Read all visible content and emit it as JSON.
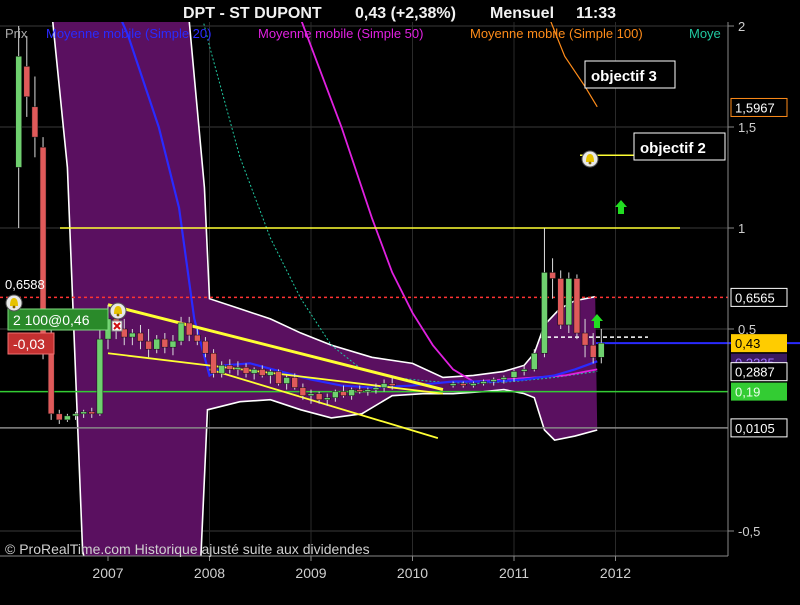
{
  "header": {
    "title": "DPT - ST DUPONT",
    "quote": "0,43 (+2,38%)",
    "period": "Mensuel",
    "time": "11:33"
  },
  "legend": {
    "price_label": "Prix",
    "items": [
      {
        "label": "Moyenne mobile (Simple 20)",
        "color": "#2a2aff"
      },
      {
        "label": "Moyenne mobile (Simple 50)",
        "color": "#e020e0"
      },
      {
        "label": "Moyenne mobile (Simple 100)",
        "color": "#ff8c1a"
      },
      {
        "label": "Moye",
        "color": "#20c8a0"
      }
    ]
  },
  "watermark": "© ProRealTime.com Historique ajusté suite aux dividendes",
  "annotations": {
    "target3": "objectif 3",
    "target2": "objectif 2",
    "position_label": "2 100@0,46",
    "pnl_label": "-0,03",
    "left_price": "0,6588"
  },
  "colors": {
    "background": "#000000",
    "band_fill": "#5a1060",
    "band_edge": "#ffffff",
    "up_candle": "#6fd06f",
    "down_candle": "#e05a5a",
    "trend_lines": "#ffff33",
    "resistance": "#ff3333",
    "support_green": "#33cc33",
    "ma20": "#2a2aff",
    "ma50": "#e020e0",
    "ma100": "#ff8c1a"
  },
  "chart_data": {
    "type": "candlestick",
    "x_axis": {
      "tick_labels": [
        "2007",
        "2008",
        "2009",
        "2010",
        "2011",
        "2012"
      ]
    },
    "y_axis": {
      "tick_labels": [
        "2",
        "1,5",
        "1",
        "0,5",
        "-0,5"
      ],
      "ticks": [
        2,
        1.5,
        1,
        0.5,
        -0.5
      ]
    },
    "right_axis_labels": [
      {
        "text": "1,5967",
        "value": 1.5967,
        "style": "outline",
        "color": "#ff8c1a"
      },
      {
        "text": "0,6565",
        "value": 0.6565,
        "style": "outline",
        "color": "#ffffff"
      },
      {
        "text": "0,43",
        "value": 0.43,
        "style": "fill",
        "color": "#ffcc00"
      },
      {
        "text": "0,3335",
        "value": 0.3335,
        "style": "fill",
        "color": "#3a1a60"
      },
      {
        "text": "0,2887",
        "value": 0.2887,
        "style": "outline",
        "color": "#ffffff"
      },
      {
        "text": "0,19",
        "value": 0.19,
        "style": "fill",
        "color": "#33cc33"
      },
      {
        "text": "0,0105",
        "value": 0.0105,
        "style": "outline",
        "color": "#ffffff"
      }
    ],
    "horizontal_levels": [
      {
        "name": "objective-1",
        "value": 1.0,
        "color": "#ffff33"
      },
      {
        "name": "objective-2",
        "value": 1.36,
        "color": "#ffff33"
      },
      {
        "name": "resistance",
        "value": 0.6565,
        "color": "#ff3333",
        "dashed": true
      },
      {
        "name": "last-price",
        "value": 0.43,
        "color": "#2a2aff"
      },
      {
        "name": "support",
        "value": 0.19,
        "color": "#33cc33"
      },
      {
        "name": "band-low",
        "value": 0.0105,
        "color": "#888888"
      }
    ],
    "candles": [
      {
        "t": 2006.12,
        "o": 1.3,
        "h": 2.0,
        "l": 1.0,
        "c": 1.85
      },
      {
        "t": 2006.2,
        "o": 1.8,
        "h": 1.95,
        "l": 1.55,
        "c": 1.65
      },
      {
        "t": 2006.28,
        "o": 1.6,
        "h": 1.75,
        "l": 1.35,
        "c": 1.45
      },
      {
        "t": 2006.36,
        "o": 1.4,
        "h": 1.45,
        "l": 0.35,
        "c": 0.4
      },
      {
        "t": 2006.44,
        "o": 0.4,
        "h": 0.5,
        "l": 0.05,
        "c": 0.08
      },
      {
        "t": 2006.52,
        "o": 0.08,
        "h": 0.1,
        "l": 0.03,
        "c": 0.05
      },
      {
        "t": 2006.6,
        "o": 0.05,
        "h": 0.08,
        "l": 0.04,
        "c": 0.07
      },
      {
        "t": 2006.68,
        "o": 0.07,
        "h": 0.09,
        "l": 0.05,
        "c": 0.08
      },
      {
        "t": 2006.76,
        "o": 0.08,
        "h": 0.1,
        "l": 0.06,
        "c": 0.09
      },
      {
        "t": 2006.84,
        "o": 0.09,
        "h": 0.11,
        "l": 0.06,
        "c": 0.08
      },
      {
        "t": 2006.92,
        "o": 0.08,
        "h": 0.5,
        "l": 0.07,
        "c": 0.45
      },
      {
        "t": 2007.0,
        "o": 0.45,
        "h": 0.62,
        "l": 0.4,
        "c": 0.55
      },
      {
        "t": 2007.08,
        "o": 0.55,
        "h": 0.6,
        "l": 0.45,
        "c": 0.5
      },
      {
        "t": 2007.16,
        "o": 0.5,
        "h": 0.55,
        "l": 0.42,
        "c": 0.46
      },
      {
        "t": 2007.24,
        "o": 0.46,
        "h": 0.5,
        "l": 0.42,
        "c": 0.48
      },
      {
        "t": 2007.32,
        "o": 0.48,
        "h": 0.52,
        "l": 0.4,
        "c": 0.44
      },
      {
        "t": 2007.4,
        "o": 0.44,
        "h": 0.5,
        "l": 0.36,
        "c": 0.4
      },
      {
        "t": 2007.48,
        "o": 0.4,
        "h": 0.47,
        "l": 0.38,
        "c": 0.45
      },
      {
        "t": 2007.56,
        "o": 0.45,
        "h": 0.48,
        "l": 0.38,
        "c": 0.41
      },
      {
        "t": 2007.64,
        "o": 0.41,
        "h": 0.47,
        "l": 0.37,
        "c": 0.44
      },
      {
        "t": 2007.72,
        "o": 0.44,
        "h": 0.56,
        "l": 0.42,
        "c": 0.53
      },
      {
        "t": 2007.8,
        "o": 0.53,
        "h": 0.56,
        "l": 0.44,
        "c": 0.47
      },
      {
        "t": 2007.88,
        "o": 0.47,
        "h": 0.5,
        "l": 0.42,
        "c": 0.44
      },
      {
        "t": 2007.96,
        "o": 0.44,
        "h": 0.46,
        "l": 0.36,
        "c": 0.38
      },
      {
        "t": 2008.04,
        "o": 0.38,
        "h": 0.4,
        "l": 0.26,
        "c": 0.28
      },
      {
        "t": 2008.12,
        "o": 0.28,
        "h": 0.34,
        "l": 0.26,
        "c": 0.32
      },
      {
        "t": 2008.2,
        "o": 0.32,
        "h": 0.35,
        "l": 0.28,
        "c": 0.3
      },
      {
        "t": 2008.28,
        "o": 0.3,
        "h": 0.34,
        "l": 0.27,
        "c": 0.31
      },
      {
        "t": 2008.36,
        "o": 0.31,
        "h": 0.33,
        "l": 0.26,
        "c": 0.28
      },
      {
        "t": 2008.44,
        "o": 0.28,
        "h": 0.31,
        "l": 0.25,
        "c": 0.3
      },
      {
        "t": 2008.52,
        "o": 0.3,
        "h": 0.32,
        "l": 0.26,
        "c": 0.27
      },
      {
        "t": 2008.6,
        "o": 0.27,
        "h": 0.3,
        "l": 0.23,
        "c": 0.29
      },
      {
        "t": 2008.68,
        "o": 0.29,
        "h": 0.3,
        "l": 0.22,
        "c": 0.23
      },
      {
        "t": 2008.76,
        "o": 0.23,
        "h": 0.27,
        "l": 0.2,
        "c": 0.26
      },
      {
        "t": 2008.84,
        "o": 0.26,
        "h": 0.28,
        "l": 0.2,
        "c": 0.21
      },
      {
        "t": 2008.92,
        "o": 0.21,
        "h": 0.23,
        "l": 0.15,
        "c": 0.17
      },
      {
        "t": 2009.0,
        "o": 0.17,
        "h": 0.2,
        "l": 0.13,
        "c": 0.18
      },
      {
        "t": 2009.08,
        "o": 0.18,
        "h": 0.19,
        "l": 0.13,
        "c": 0.15
      },
      {
        "t": 2009.16,
        "o": 0.15,
        "h": 0.18,
        "l": 0.12,
        "c": 0.16
      },
      {
        "t": 2009.24,
        "o": 0.16,
        "h": 0.2,
        "l": 0.14,
        "c": 0.19
      },
      {
        "t": 2009.32,
        "o": 0.19,
        "h": 0.22,
        "l": 0.16,
        "c": 0.17
      },
      {
        "t": 2009.4,
        "o": 0.17,
        "h": 0.21,
        "l": 0.15,
        "c": 0.2
      },
      {
        "t": 2009.48,
        "o": 0.2,
        "h": 0.22,
        "l": 0.18,
        "c": 0.19
      },
      {
        "t": 2009.56,
        "o": 0.19,
        "h": 0.21,
        "l": 0.17,
        "c": 0.2
      },
      {
        "t": 2009.64,
        "o": 0.2,
        "h": 0.23,
        "l": 0.18,
        "c": 0.21
      },
      {
        "t": 2009.72,
        "o": 0.21,
        "h": 0.25,
        "l": 0.19,
        "c": 0.23
      },
      {
        "t": 2009.8,
        "o": 0.23,
        "h": 0.26,
        "l": 0.2,
        "c": 0.22
      },
      {
        "t": 2010.4,
        "o": 0.22,
        "h": 0.24,
        "l": 0.21,
        "c": 0.23
      },
      {
        "t": 2010.5,
        "o": 0.23,
        "h": 0.24,
        "l": 0.21,
        "c": 0.22
      },
      {
        "t": 2010.6,
        "o": 0.22,
        "h": 0.24,
        "l": 0.21,
        "c": 0.23
      },
      {
        "t": 2010.7,
        "o": 0.23,
        "h": 0.25,
        "l": 0.22,
        "c": 0.24
      },
      {
        "t": 2010.8,
        "o": 0.24,
        "h": 0.26,
        "l": 0.22,
        "c": 0.25
      },
      {
        "t": 2010.9,
        "o": 0.25,
        "h": 0.27,
        "l": 0.23,
        "c": 0.26
      },
      {
        "t": 2011.0,
        "o": 0.26,
        "h": 0.3,
        "l": 0.24,
        "c": 0.29
      },
      {
        "t": 2011.1,
        "o": 0.29,
        "h": 0.32,
        "l": 0.27,
        "c": 0.3
      },
      {
        "t": 2011.2,
        "o": 0.3,
        "h": 0.4,
        "l": 0.29,
        "c": 0.38
      },
      {
        "t": 2011.3,
        "o": 0.38,
        "h": 1.0,
        "l": 0.36,
        "c": 0.78
      },
      {
        "t": 2011.38,
        "o": 0.78,
        "h": 0.85,
        "l": 0.65,
        "c": 0.75
      },
      {
        "t": 2011.46,
        "o": 0.75,
        "h": 0.79,
        "l": 0.5,
        "c": 0.52
      },
      {
        "t": 2011.54,
        "o": 0.52,
        "h": 0.78,
        "l": 0.48,
        "c": 0.75
      },
      {
        "t": 2011.62,
        "o": 0.75,
        "h": 0.77,
        "l": 0.45,
        "c": 0.48
      },
      {
        "t": 2011.7,
        "o": 0.48,
        "h": 0.55,
        "l": 0.36,
        "c": 0.42
      },
      {
        "t": 2011.78,
        "o": 0.42,
        "h": 0.48,
        "l": 0.33,
        "c": 0.36
      },
      {
        "t": 2011.86,
        "o": 0.36,
        "h": 0.5,
        "l": 0.33,
        "c": 0.43
      }
    ],
    "bollinger_upper": [
      [
        2006.4,
        2.3
      ],
      [
        2006.6,
        2.3
      ],
      [
        2006.9,
        2.3
      ],
      [
        2007.2,
        2.3
      ],
      [
        2007.6,
        2.3
      ],
      [
        2007.75,
        2.3
      ],
      [
        2007.95,
        1.2
      ],
      [
        2008.0,
        0.65
      ],
      [
        2008.3,
        0.6
      ],
      [
        2008.6,
        0.55
      ],
      [
        2008.9,
        0.48
      ],
      [
        2009.2,
        0.42
      ],
      [
        2009.6,
        0.36
      ],
      [
        2010.0,
        0.33
      ],
      [
        2010.3,
        0.26
      ],
      [
        2010.6,
        0.27
      ],
      [
        2010.9,
        0.29
      ],
      [
        2011.1,
        0.32
      ],
      [
        2011.2,
        0.38
      ],
      [
        2011.3,
        0.52
      ],
      [
        2011.45,
        0.6
      ],
      [
        2011.6,
        0.64
      ],
      [
        2011.8,
        0.66
      ]
    ],
    "bollinger_lower": [
      [
        2006.4,
        2.3
      ],
      [
        2006.6,
        1.3
      ],
      [
        2006.75,
        -0.6
      ],
      [
        2006.85,
        -0.8
      ],
      [
        2007.0,
        -0.8
      ],
      [
        2007.5,
        -0.8
      ],
      [
        2007.9,
        -0.8
      ],
      [
        2007.98,
        0.1
      ],
      [
        2008.3,
        0.14
      ],
      [
        2008.6,
        0.15
      ],
      [
        2008.9,
        0.1
      ],
      [
        2009.2,
        0.06
      ],
      [
        2009.5,
        0.08
      ],
      [
        2009.8,
        0.17
      ],
      [
        2010.1,
        0.18
      ],
      [
        2010.4,
        0.18
      ],
      [
        2010.7,
        0.19
      ],
      [
        2010.9,
        0.2
      ],
      [
        2011.1,
        0.18
      ],
      [
        2011.2,
        0.16
      ],
      [
        2011.3,
        0.0
      ],
      [
        2011.4,
        -0.05
      ],
      [
        2011.6,
        -0.03
      ],
      [
        2011.82,
        0.0
      ]
    ],
    "ma20": [
      [
        2006.9,
        2.3
      ],
      [
        2007.2,
        1.95
      ],
      [
        2007.5,
        1.5
      ],
      [
        2007.7,
        1.1
      ],
      [
        2007.85,
        0.55
      ],
      [
        2008.0,
        0.27
      ],
      [
        2008.15,
        0.32
      ],
      [
        2008.4,
        0.33
      ],
      [
        2008.7,
        0.29
      ],
      [
        2009.0,
        0.25
      ],
      [
        2009.3,
        0.22
      ],
      [
        2009.6,
        0.21
      ],
      [
        2010.0,
        0.22
      ],
      [
        2010.4,
        0.24
      ],
      [
        2010.8,
        0.24
      ],
      [
        2011.1,
        0.25
      ],
      [
        2011.4,
        0.27
      ],
      [
        2011.6,
        0.3
      ],
      [
        2011.82,
        0.34
      ]
    ],
    "ma50": [
      [
        2008.7,
        2.3
      ],
      [
        2009.0,
        1.9
      ],
      [
        2009.3,
        1.5
      ],
      [
        2009.6,
        1.05
      ],
      [
        2009.8,
        0.78
      ],
      [
        2010.0,
        0.58
      ],
      [
        2010.2,
        0.42
      ],
      [
        2010.4,
        0.3
      ],
      [
        2010.6,
        0.24
      ],
      [
        2010.9,
        0.25
      ],
      [
        2011.2,
        0.26
      ],
      [
        2011.5,
        0.27
      ],
      [
        2011.82,
        0.3
      ]
    ],
    "ma100": [
      [
        2011.1,
        2.3
      ],
      [
        2011.3,
        2.1
      ],
      [
        2011.5,
        1.85
      ],
      [
        2011.7,
        1.7
      ],
      [
        2011.82,
        1.6
      ]
    ],
    "ma_teal": [
      [
        2007.8,
        2.3
      ],
      [
        2008.0,
        1.9
      ],
      [
        2008.3,
        1.35
      ],
      [
        2008.6,
        0.95
      ],
      [
        2008.9,
        0.65
      ],
      [
        2009.2,
        0.42
      ],
      [
        2009.5,
        0.3
      ],
      [
        2009.8,
        0.26
      ],
      [
        2010.2,
        0.24
      ],
      [
        2010.6,
        0.23
      ],
      [
        2011.0,
        0.24
      ],
      [
        2011.4,
        0.26
      ],
      [
        2011.82,
        0.29
      ]
    ],
    "trend_channel": [
      {
        "name": "upper",
        "from": [
          2007.0,
          0.62
        ],
        "to": [
          2010.3,
          0.2
        ]
      },
      {
        "name": "middle",
        "from": [
          2007.0,
          0.38
        ],
        "to": [
          2010.3,
          0.18
        ]
      },
      {
        "name": "lower",
        "from": [
          2008.0,
          0.3
        ],
        "to": [
          2010.25,
          -0.04
        ]
      }
    ]
  }
}
